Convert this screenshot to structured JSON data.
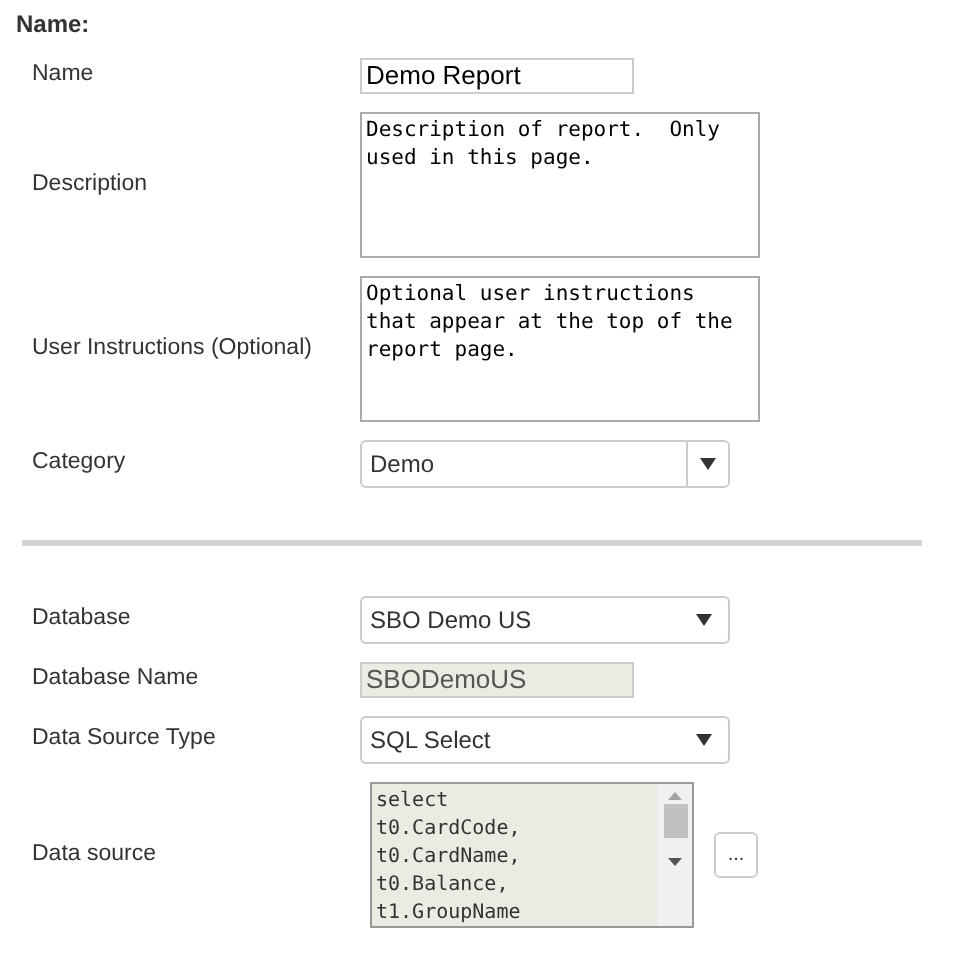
{
  "sections": [
    {
      "heading": "Name:",
      "fields": [
        {
          "kind": "input",
          "label": "Name",
          "value": "Demo Report"
        },
        {
          "kind": "textarea",
          "label": "Description",
          "value": "Description of report.  Only used in this page."
        },
        {
          "kind": "textarea",
          "label": "User Instructions (Optional)",
          "value": "Optional user instructions that appear at the top of the report page."
        },
        {
          "kind": "combo",
          "label": "Category",
          "value": "Demo"
        }
      ]
    },
    {
      "fields": [
        {
          "kind": "select",
          "label": "Database",
          "value": "SBO Demo US"
        },
        {
          "kind": "readonly",
          "label": "Database Name",
          "value": "SBODemoUS"
        },
        {
          "kind": "select",
          "label": "Data Source Type",
          "value": "SQL Select"
        },
        {
          "kind": "code",
          "label": "Data source",
          "value": "select\nt0.CardCode,\nt0.CardName,\nt0.Balance,\nt1.GroupName",
          "button": "..."
        }
      ]
    }
  ]
}
